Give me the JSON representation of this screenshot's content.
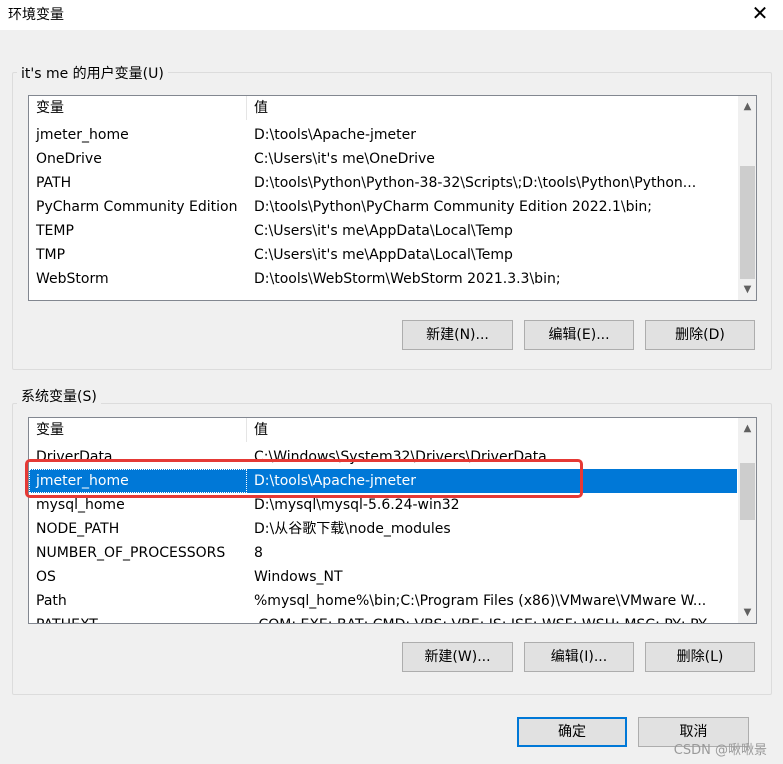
{
  "window": {
    "title": "环境变量",
    "close_glyph": "✕"
  },
  "user_vars": {
    "group_label": "it's me 的用户变量(U)",
    "headers": [
      "变量",
      "值"
    ],
    "rows": [
      [
        "jmeter_home",
        "D:\\tools\\Apache-jmeter"
      ],
      [
        "OneDrive",
        "C:\\Users\\it's me\\OneDrive"
      ],
      [
        "PATH",
        "D:\\tools\\Python\\Python-38-32\\Scripts\\;D:\\tools\\Python\\Python..."
      ],
      [
        "PyCharm Community Edition",
        "D:\\tools\\Python\\PyCharm Community Edition 2022.1\\bin;"
      ],
      [
        "TEMP",
        "C:\\Users\\it's me\\AppData\\Local\\Temp"
      ],
      [
        "TMP",
        "C:\\Users\\it's me\\AppData\\Local\\Temp"
      ],
      [
        "WebStorm",
        "D:\\tools\\WebStorm\\WebStorm 2021.3.3\\bin;"
      ]
    ],
    "buttons": {
      "new": "新建(N)...",
      "edit": "编辑(E)...",
      "delete": "删除(D)"
    }
  },
  "system_vars": {
    "group_label": "系统变量(S)",
    "headers": [
      "变量",
      "值"
    ],
    "rows": [
      [
        "DriverData",
        "C:\\Windows\\System32\\Drivers\\DriverData"
      ],
      [
        "jmeter_home",
        "D:\\tools\\Apache-jmeter"
      ],
      [
        "mysql_home",
        "D:\\mysql\\mysql-5.6.24-win32"
      ],
      [
        "NODE_PATH",
        "D:\\从谷歌下载\\node_modules"
      ],
      [
        "NUMBER_OF_PROCESSORS",
        "8"
      ],
      [
        "OS",
        "Windows_NT"
      ],
      [
        "Path",
        "%mysql_home%\\bin;C:\\Program Files (x86)\\VMware\\VMware W..."
      ],
      [
        "PATHEXT",
        ".COM;.EXE;.BAT;.CMD;.VBS;.VBE;.JS;.JSE;.WSF;.WSH;.MSC;.PY;.PY..."
      ]
    ],
    "selected_index": 1,
    "buttons": {
      "new": "新建(W)...",
      "edit": "编辑(I)...",
      "delete": "删除(L)"
    }
  },
  "footer": {
    "ok": "确定",
    "cancel": "取消"
  },
  "watermark": "CSDN @啾啾景",
  "colors": {
    "selection": "#0078d7",
    "highlight": "#e53935",
    "default_button_border": "#0078d7"
  }
}
